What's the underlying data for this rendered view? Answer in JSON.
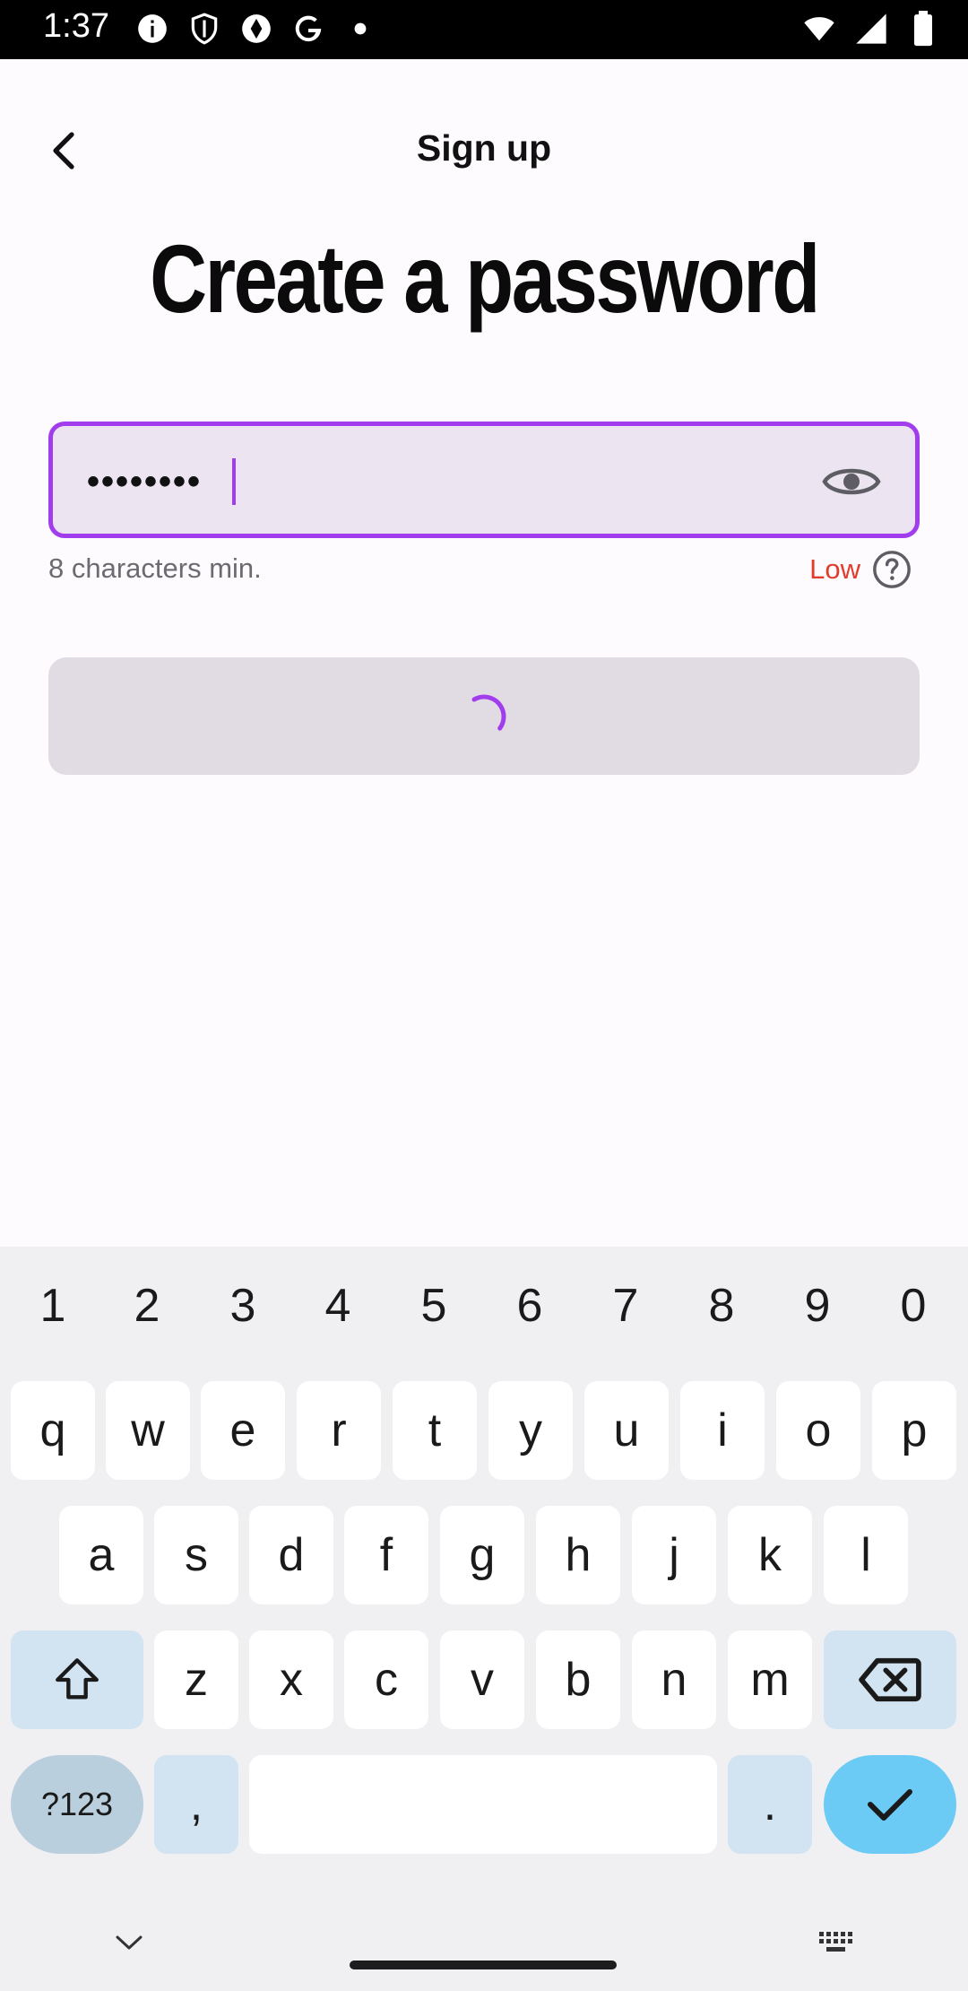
{
  "status_bar": {
    "time": "1:37",
    "left_icons": [
      "info-icon",
      "shield-icon",
      "camera-aperture-icon",
      "google-g-icon",
      "dot-icon"
    ],
    "right_icons": [
      "wifi-icon",
      "signal-icon",
      "battery-icon"
    ]
  },
  "app_bar": {
    "title": "Sign up",
    "back_icon": "chevron-left-icon"
  },
  "page": {
    "heading": "Create a password"
  },
  "password_field": {
    "value": "••••••••",
    "visibility_icon": "eye-icon",
    "accent_color": "#a23ded"
  },
  "helper": {
    "min_text": "8 characters min.",
    "strength": "Low",
    "strength_color": "#e23c2c",
    "help_icon": "question-circle-icon"
  },
  "submit_button": {
    "state": "loading",
    "spinner_color": "#a23ded"
  },
  "keyboard": {
    "numbers": [
      "1",
      "2",
      "3",
      "4",
      "5",
      "6",
      "7",
      "8",
      "9",
      "0"
    ],
    "row1": [
      "q",
      "w",
      "e",
      "r",
      "t",
      "y",
      "u",
      "i",
      "o",
      "p"
    ],
    "row2": [
      "a",
      "s",
      "d",
      "f",
      "g",
      "h",
      "j",
      "k",
      "l"
    ],
    "row3": [
      "z",
      "x",
      "c",
      "v",
      "b",
      "n",
      "m"
    ],
    "symbols_label": "?123",
    "comma": ",",
    "period": ".",
    "shift_icon": "shift-icon",
    "backspace_icon": "backspace-icon",
    "enter_icon": "checkmark-icon"
  },
  "nav_bar": {
    "hide_keyboard_icon": "chevron-down-icon",
    "switch_keyboard_icon": "keyboard-icon"
  }
}
